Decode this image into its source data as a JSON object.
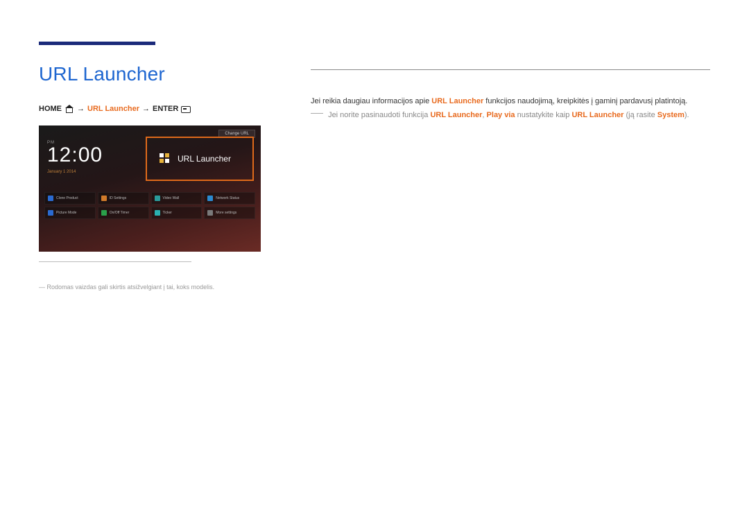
{
  "page": {
    "title": "URL Launcher"
  },
  "breadcrumb": {
    "home": "HOME",
    "item": "URL Launcher",
    "enter": "ENTER"
  },
  "screenshot": {
    "change_url": "Change URL",
    "ampm": "PM",
    "time": "12:00",
    "date": "January 1 2014",
    "url_launcher": "URL Launcher",
    "buttons": [
      {
        "label": "Clone Product",
        "colorClass": "c-blue"
      },
      {
        "label": "ID Settings",
        "colorClass": "c-orange"
      },
      {
        "label": "Video Wall",
        "colorClass": "c-teal"
      },
      {
        "label": "Network Status",
        "colorClass": "c-blue2"
      },
      {
        "label": "Picture Mode",
        "colorClass": "c-blue"
      },
      {
        "label": "On/Off Timer",
        "colorClass": "c-green"
      },
      {
        "label": "Ticker",
        "colorClass": "c-cyan"
      },
      {
        "label": "More settings",
        "colorClass": "c-grey"
      }
    ]
  },
  "footnote": "Rodomas vaizdas gali skirtis atsižvelgiant į tai, koks modelis.",
  "body": {
    "line1_pre": "Jei reikia daugiau informacijos apie ",
    "line1_hl": "URL Launcher",
    "line1_post": " funkcijos naudojimą, kreipkitės į gaminį pardavusį platintoją.",
    "line2_pre": "Jei norite pasinaudoti funkcija ",
    "line2_hl1": "URL Launcher",
    "line2_mid1": ", ",
    "line2_hl2": "Play via",
    "line2_mid2": " nustatykite kaip ",
    "line2_hl3": "URL Launcher",
    "line2_mid3": " (ją rasite ",
    "line2_hl4": "System",
    "line2_post": ")."
  }
}
